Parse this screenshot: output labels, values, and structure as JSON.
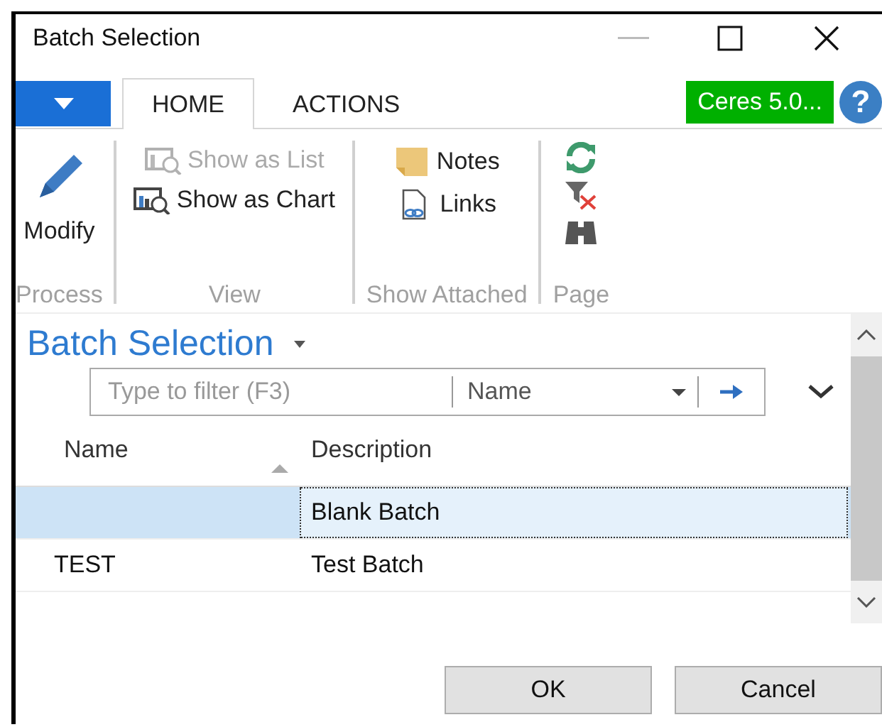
{
  "window": {
    "title": "Batch Selection"
  },
  "tabs": [
    {
      "label": "HOME",
      "selected": true
    },
    {
      "label": "ACTIONS",
      "selected": false
    }
  ],
  "company_badge": "Ceres 5.0...",
  "help_icon": "?",
  "ribbon": [
    {
      "label": "Process",
      "kind": "large",
      "items": [
        {
          "label": "Modify",
          "disabled": false
        }
      ]
    },
    {
      "label": "View",
      "kind": "small",
      "items": [
        {
          "label": "Show as List",
          "disabled": true
        },
        {
          "label": "Show as Chart",
          "disabled": false
        }
      ]
    },
    {
      "label": "Show Attached",
      "kind": "small",
      "items": [
        {
          "label": "Notes",
          "disabled": false
        },
        {
          "label": "Links",
          "disabled": false
        }
      ]
    },
    {
      "label": "Page",
      "kind": "icons",
      "items": [
        {
          "disabled": false
        },
        {
          "disabled": false
        },
        {
          "disabled": false
        }
      ]
    }
  ],
  "page_title": "Batch Selection",
  "filter": {
    "placeholder": "Type to filter (F3)",
    "field": "Name"
  },
  "table": {
    "columns": [
      {
        "label": "Name",
        "sorted": true
      },
      {
        "label": "Description",
        "sorted": false
      }
    ],
    "rows": [
      {
        "cells": [
          "",
          "Blank Batch"
        ],
        "selected": true
      },
      {
        "cells": [
          "TEST",
          "Test Batch"
        ],
        "selected": false
      }
    ]
  },
  "buttons": [
    "OK",
    "Cancel"
  ]
}
